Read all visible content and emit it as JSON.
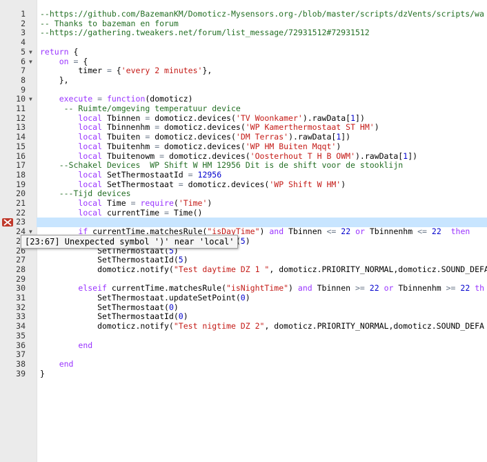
{
  "editor": {
    "error_line": 23,
    "active_line": 23,
    "tooltip": "[23:67] Unexpected symbol ')' near 'local'",
    "fold_lines": [
      5,
      6,
      10,
      24
    ],
    "lines": [
      [
        [
          "c",
          "--https://github.com/BazemanKM/Domoticz-Mysensors.org-/blob/master/scripts/dzVents/scripts/wa"
        ]
      ],
      [
        [
          "c",
          "-- Thanks to bazeman en forum"
        ]
      ],
      [
        [
          "c",
          "--https://gathering.tweakers.net/forum/list_message/72931512#72931512"
        ]
      ],
      [],
      [
        [
          "k",
          "return"
        ],
        [
          "t",
          " {"
        ]
      ],
      [
        [
          "t",
          "    "
        ],
        [
          "k",
          "on"
        ],
        [
          "t",
          " "
        ],
        [
          "o",
          "="
        ],
        [
          "t",
          " {"
        ]
      ],
      [
        [
          "t",
          "        timer "
        ],
        [
          "o",
          "="
        ],
        [
          "t",
          " {"
        ],
        [
          "s",
          "'every 2 minutes'"
        ],
        [
          "t",
          "},"
        ]
      ],
      [
        [
          "t",
          "    },"
        ]
      ],
      [],
      [
        [
          "t",
          "    "
        ],
        [
          "k",
          "execute"
        ],
        [
          "t",
          " "
        ],
        [
          "o",
          "="
        ],
        [
          "t",
          " "
        ],
        [
          "k",
          "function"
        ],
        [
          "t",
          "(domoticz)"
        ]
      ],
      [
        [
          "t",
          "     "
        ],
        [
          "c",
          "-- Ruimte/omgeving temperatuur device"
        ]
      ],
      [
        [
          "t",
          "        "
        ],
        [
          "k",
          "local"
        ],
        [
          "t",
          " Tbinnen "
        ],
        [
          "o",
          "="
        ],
        [
          "t",
          " domoticz.devices("
        ],
        [
          "s",
          "'TV Woonkamer'"
        ],
        [
          "t",
          ").rawData["
        ],
        [
          "n",
          "1"
        ],
        [
          "t",
          "])"
        ]
      ],
      [
        [
          "t",
          "        "
        ],
        [
          "k",
          "local"
        ],
        [
          "t",
          " Tbinnenhm "
        ],
        [
          "o",
          "="
        ],
        [
          "t",
          " domoticz.devices("
        ],
        [
          "s",
          "'WP Kamerthermostaat ST HM'"
        ],
        [
          "t",
          ")"
        ]
      ],
      [
        [
          "t",
          "        "
        ],
        [
          "k",
          "local"
        ],
        [
          "t",
          " Tbuiten "
        ],
        [
          "o",
          "="
        ],
        [
          "t",
          " domoticz.devices("
        ],
        [
          "s",
          "'DM Terras'"
        ],
        [
          "t",
          ").rawData["
        ],
        [
          "n",
          "1"
        ],
        [
          "t",
          "])"
        ]
      ],
      [
        [
          "t",
          "        "
        ],
        [
          "k",
          "local"
        ],
        [
          "t",
          " Tbuitenhm "
        ],
        [
          "o",
          "="
        ],
        [
          "t",
          " domoticz.devices("
        ],
        [
          "s",
          "'WP HM Buiten Mqqt'"
        ],
        [
          "t",
          ")"
        ]
      ],
      [
        [
          "t",
          "        "
        ],
        [
          "k",
          "local"
        ],
        [
          "t",
          " Tbuitenowm "
        ],
        [
          "o",
          "="
        ],
        [
          "t",
          " domoticz.devices("
        ],
        [
          "s",
          "'Oosterhout T H B OWM'"
        ],
        [
          "t",
          ").rawData["
        ],
        [
          "n",
          "1"
        ],
        [
          "t",
          "])"
        ]
      ],
      [
        [
          "t",
          "    "
        ],
        [
          "c",
          "--Schakel Devices  WP Shift W HM 12956 Dit is de shift voor de stooklijn"
        ]
      ],
      [
        [
          "t",
          "        "
        ],
        [
          "k",
          "local"
        ],
        [
          "t",
          " SetThermostaatId "
        ],
        [
          "o",
          "="
        ],
        [
          "t",
          " "
        ],
        [
          "n",
          "12956"
        ]
      ],
      [
        [
          "t",
          "        "
        ],
        [
          "k",
          "local"
        ],
        [
          "t",
          " SetThermostaat "
        ],
        [
          "o",
          "="
        ],
        [
          "t",
          " domoticz.devices("
        ],
        [
          "s",
          "'WP Shift W HM'"
        ],
        [
          "t",
          ")"
        ]
      ],
      [
        [
          "t",
          "    "
        ],
        [
          "c",
          "---Tijd devices"
        ]
      ],
      [
        [
          "t",
          "        "
        ],
        [
          "k",
          "local"
        ],
        [
          "t",
          " Time "
        ],
        [
          "o",
          "="
        ],
        [
          "t",
          " "
        ],
        [
          "k",
          "require"
        ],
        [
          "t",
          "("
        ],
        [
          "s",
          "'Time'"
        ],
        [
          "t",
          ")"
        ]
      ],
      [
        [
          "t",
          "        "
        ],
        [
          "k",
          "local"
        ],
        [
          "t",
          " currentTime "
        ],
        [
          "o",
          "="
        ],
        [
          "t",
          " Time()"
        ]
      ],
      [],
      [
        [
          "t",
          "        "
        ],
        [
          "k",
          "if"
        ],
        [
          "t",
          " currentTime.matchesRule("
        ],
        [
          "s",
          "\"isDayTime\""
        ],
        [
          "t",
          ") "
        ],
        [
          "k",
          "and"
        ],
        [
          "t",
          " Tbinnen "
        ],
        [
          "o",
          "<="
        ],
        [
          "t",
          " "
        ],
        [
          "n",
          "22"
        ],
        [
          "t",
          " "
        ],
        [
          "k",
          "or"
        ],
        [
          "t",
          " Tbinnenhm "
        ],
        [
          "o",
          "<="
        ],
        [
          "t",
          " "
        ],
        [
          "n",
          "22"
        ],
        [
          "t",
          "  "
        ],
        [
          "k",
          "then"
        ]
      ],
      [
        [
          "t",
          "            SetThermostaat.updateSetPoint("
        ],
        [
          "n",
          "5"
        ],
        [
          "t",
          ")"
        ]
      ],
      [
        [
          "t",
          "            SetThermostaat("
        ],
        [
          "n",
          "5"
        ],
        [
          "t",
          ")"
        ]
      ],
      [
        [
          "t",
          "            SetThermostaatId("
        ],
        [
          "n",
          "5"
        ],
        [
          "t",
          ")"
        ]
      ],
      [
        [
          "t",
          "            domoticz.notify("
        ],
        [
          "s",
          "\"Test daytime DZ 1 \""
        ],
        [
          "t",
          ", domoticz.PRIORITY_NORMAL,domoticz.SOUND_DEFA"
        ]
      ],
      [],
      [
        [
          "t",
          "        "
        ],
        [
          "k",
          "elseif"
        ],
        [
          "t",
          " currentTime.matchesRule("
        ],
        [
          "s",
          "\"isNightTime\""
        ],
        [
          "t",
          ") "
        ],
        [
          "k",
          "and"
        ],
        [
          "t",
          " Tbinnen "
        ],
        [
          "o",
          ">="
        ],
        [
          "t",
          " "
        ],
        [
          "n",
          "22"
        ],
        [
          "t",
          " "
        ],
        [
          "k",
          "or"
        ],
        [
          "t",
          " Tbinnenhm "
        ],
        [
          "o",
          ">="
        ],
        [
          "t",
          " "
        ],
        [
          "n",
          "22"
        ],
        [
          "t",
          " "
        ],
        [
          "k",
          "th"
        ]
      ],
      [
        [
          "t",
          "            SetThermostaat.updateSetPoint("
        ],
        [
          "n",
          "0"
        ],
        [
          "t",
          ")"
        ]
      ],
      [
        [
          "t",
          "            SetThermostaat("
        ],
        [
          "n",
          "0"
        ],
        [
          "t",
          ")"
        ]
      ],
      [
        [
          "t",
          "            SetThermostaatId("
        ],
        [
          "n",
          "0"
        ],
        [
          "t",
          ")"
        ]
      ],
      [
        [
          "t",
          "            domoticz.notify("
        ],
        [
          "s",
          "\"Test nigtime DZ 2\""
        ],
        [
          "t",
          ", domoticz.PRIORITY_NORMAL,domoticz.SOUND_DEFA"
        ]
      ],
      [],
      [
        [
          "t",
          "        "
        ],
        [
          "k",
          "end"
        ]
      ],
      [],
      [
        [
          "t",
          "    "
        ],
        [
          "k",
          "end"
        ]
      ],
      [
        [
          "t",
          "}"
        ]
      ]
    ]
  }
}
